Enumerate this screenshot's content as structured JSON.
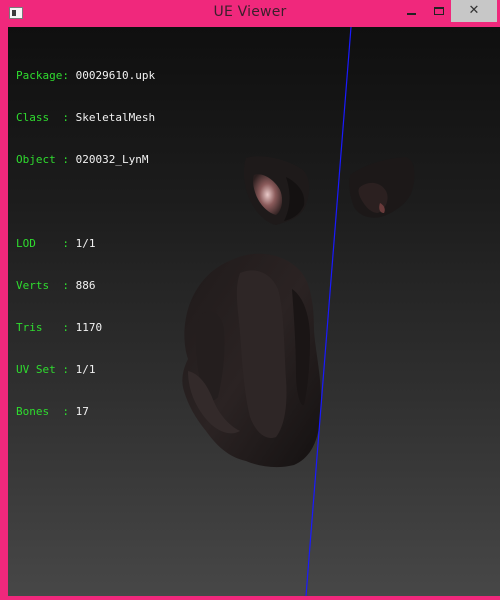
{
  "window": {
    "title": "UE Viewer",
    "controls": {
      "minimize_icon": "minimize-icon",
      "maximize_icon": "maximize-icon",
      "close_label": "✕"
    },
    "accent_color": "#f0287c"
  },
  "info": {
    "package": {
      "label": "Package:",
      "value": "00029610.upk"
    },
    "class": {
      "label": "Class  :",
      "value": "SkeletalMesh"
    },
    "object": {
      "label": "Object :",
      "value": "020032_LynM"
    },
    "lod": {
      "label": "LOD    :",
      "value": "1/1"
    },
    "verts": {
      "label": "Verts  :",
      "value": "886"
    },
    "tris": {
      "label": "Tris   :",
      "value": "1170"
    },
    "uvset": {
      "label": "UV Set :",
      "value": "1/1"
    },
    "bones": {
      "label": "Bones  :",
      "value": "17"
    }
  },
  "colors": {
    "label_text": "#2fdc2f",
    "value_text": "#f2f2f2",
    "axis_line": "#1a1aff"
  }
}
